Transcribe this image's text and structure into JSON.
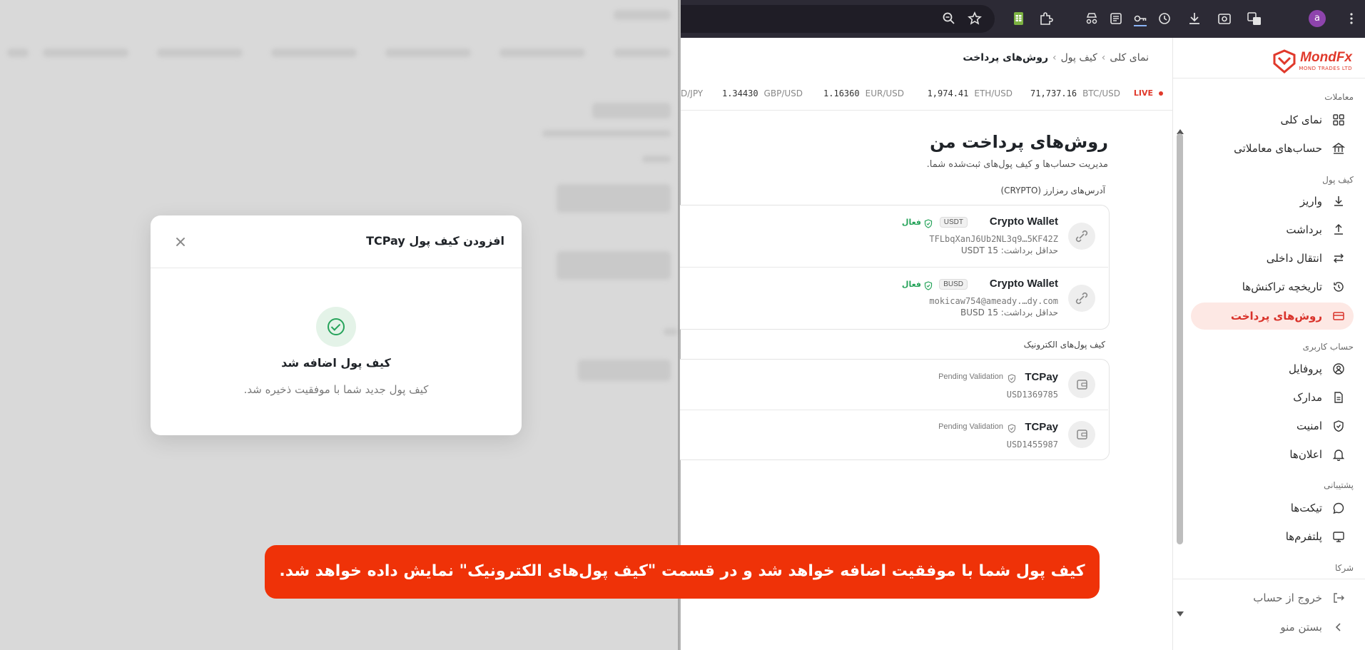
{
  "modal": {
    "title": "افزودن کیف پول TCPay",
    "success_title": "کیف پول اضافه شد",
    "success_message": "کیف پول جدید شما با موفقیت ذخیره شد."
  },
  "browser": {
    "avatar_letter": "a",
    "toolbar_icons": [
      "zoom-icon",
      "star-icon",
      "extension-sheets-icon",
      "puzzle-icon",
      "spy-icon",
      "reader-icon",
      "key-icon",
      "history-icon",
      "download-icon",
      "screenshot-icon",
      "translate-icon",
      "menu-dots-icon"
    ]
  },
  "brand": {
    "name": "MondFx",
    "tagline": "MOND TRADES LTD",
    "color": "#e0392b"
  },
  "breadcrumb": {
    "home": "نمای کلی",
    "wallet": "کیف پول",
    "current": "روش‌های پرداخت"
  },
  "ticker": {
    "live_label": "LIVE",
    "items": [
      {
        "pair": "BTC/USD",
        "price": "71,737.16"
      },
      {
        "pair": "ETH/USD",
        "price": "1,974.41"
      },
      {
        "pair": "EUR/USD",
        "price": "1.16360"
      },
      {
        "pair": "GBP/USD",
        "price": "1.34430"
      },
      {
        "pair": "D/JPY",
        "price": ""
      }
    ]
  },
  "page": {
    "title": "روش‌های پرداخت من",
    "subtitle": "مدیریت حساب‌ها و کیف پول‌های ثبت‌شده شما."
  },
  "crypto": {
    "label": "آدرس‌های رمزارز (CRYPTO)",
    "items": [
      {
        "name": "Crypto Wallet",
        "token": "USDT",
        "status": "فعال",
        "address": "TFLbqXanJ6Ub2NL3q9…5KF42Z",
        "min": "حداقل برداشت: 15 USDT"
      },
      {
        "name": "Crypto Wallet",
        "token": "BUSD",
        "status": "فعال",
        "address": "mokicaw754@ameady.…dy.com",
        "min": "حداقل برداشت: 15 BUSD"
      }
    ]
  },
  "ewallets": {
    "label": "کیف پول‌های الکترونیک",
    "items": [
      {
        "name": "TCPay",
        "status": "Pending Validation",
        "account": "USD1369785"
      },
      {
        "name": "TCPay",
        "status": "Pending Validation",
        "account": "USD1455987"
      }
    ]
  },
  "sidebar": {
    "sections": {
      "trading": "معاملات",
      "wallet": "کیف پول",
      "account": "حساب کاربری",
      "support": "پشتیبانی",
      "partners": "شرکا"
    },
    "items": [
      {
        "label": "نمای کلی",
        "icon": "grid-icon"
      },
      {
        "label": "حساب‌های معاملاتی",
        "icon": "bank-icon"
      },
      {
        "label": "واریز",
        "icon": "download-icon"
      },
      {
        "label": "برداشت",
        "icon": "upload-icon"
      },
      {
        "label": "انتقال داخلی",
        "icon": "transfer-icon"
      },
      {
        "label": "تاریخچه تراکنش‌ها",
        "icon": "history-icon"
      },
      {
        "label": "روش‌های پرداخت",
        "icon": "card-icon"
      },
      {
        "label": "پروفایل",
        "icon": "user-circle-icon"
      },
      {
        "label": "مدارک",
        "icon": "document-icon"
      },
      {
        "label": "امنیت",
        "icon": "shield-icon"
      },
      {
        "label": "اعلان‌ها",
        "icon": "bell-icon"
      },
      {
        "label": "تیکت‌ها",
        "icon": "chat-icon"
      },
      {
        "label": "پلتفرم‌ها",
        "icon": "monitor-icon"
      }
    ],
    "logout": "خروج از حساب",
    "collapse": "بستن منو"
  },
  "banner": {
    "text": "کیف پول شما با موفقیت اضافه خواهد شد و در قسمت \"کیف پول‌های الکترونیک\" نمایش داده خواهد شد.",
    "color": "#ef3208"
  }
}
